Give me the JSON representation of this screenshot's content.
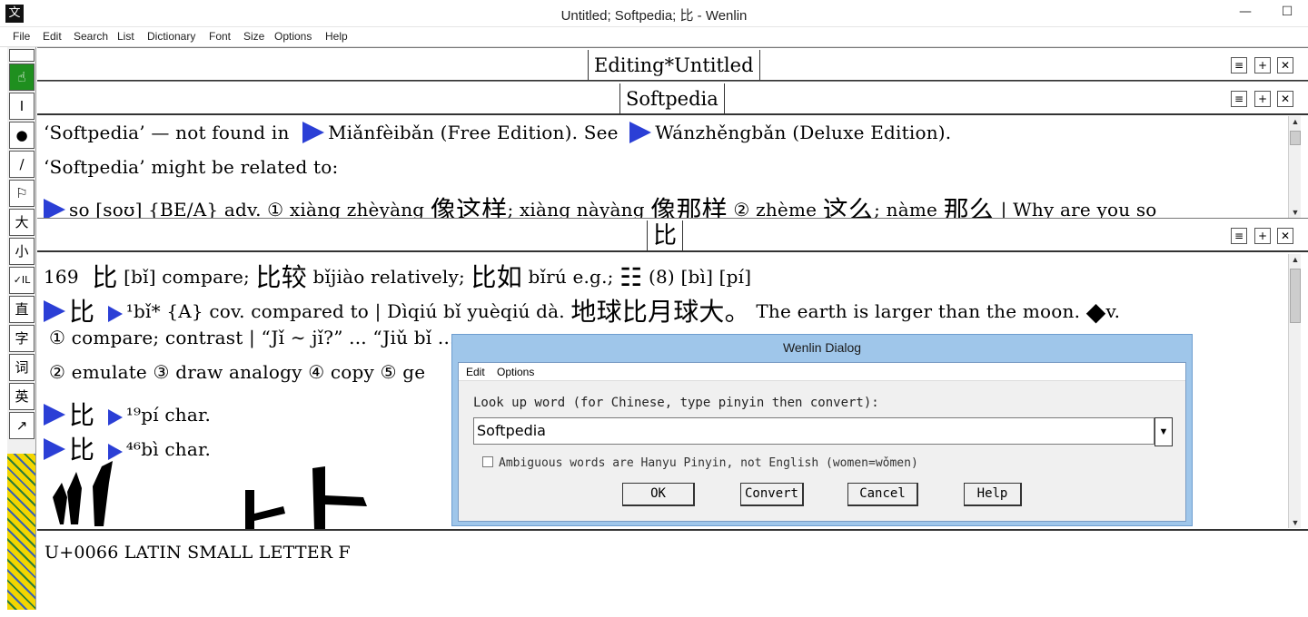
{
  "window": {
    "title": "Untitled; Softpedia; 比 - Wenlin",
    "app_icon": "文",
    "minimize": "—",
    "maximize": "☐",
    "close": "✕"
  },
  "menu": [
    "File",
    "Edit",
    "Search",
    "List",
    "Dictionary",
    "Font",
    "Size",
    "Options",
    "Help"
  ],
  "toolbar": [
    {
      "icon": "hand-icon",
      "glyph": "☝"
    },
    {
      "icon": "text-cursor-icon",
      "glyph": "I"
    },
    {
      "icon": "dot-icon",
      "glyph": "●"
    },
    {
      "icon": "brush-icon",
      "glyph": "∕"
    },
    {
      "icon": "flag-icon",
      "glyph": "⚐"
    },
    {
      "icon": "big-char-icon",
      "glyph": "大"
    },
    {
      "icon": "small-char-icon",
      "glyph": "小"
    },
    {
      "icon": "check-il-icon",
      "glyph": "✓IL"
    },
    {
      "icon": "vertical-icon",
      "glyph": "直"
    },
    {
      "icon": "character-icon",
      "glyph": "字"
    },
    {
      "icon": "word-icon",
      "glyph": "词"
    },
    {
      "icon": "english-icon",
      "glyph": "英"
    },
    {
      "icon": "arrow-icon",
      "glyph": "↗"
    }
  ],
  "pane_controls": {
    "menu": "≡",
    "add": "+",
    "close": "✕"
  },
  "editing_pane": {
    "title": "Editing*Untitled"
  },
  "softpedia_pane": {
    "title": "Softpedia",
    "line1_a": "‘Softpedia’ — not found in",
    "line1_b": "Miǎnfèibǎn (Free Edition). See",
    "line1_c": "Wánzhěngbǎn (Deluxe Edition).",
    "line2": "‘Softpedia’ might be related to:",
    "line3_a": "so [soʊ] {BE/A} adv. ① xiàng zhèyàng",
    "line3_b": "像这样",
    "line3_c": "; xiàng nàyàng",
    "line3_d": "像那样",
    "line3_e": " ② zhème",
    "line3_f": "这么",
    "line3_g": "; nàme",
    "line3_h": "那么",
    "line3_i": "| Why are you so"
  },
  "bi_pane": {
    "title": "比",
    "l1_a": "169",
    "l1_b": "比",
    "l1_c": "[bǐ] compare;",
    "l1_d": "比较",
    "l1_e": "bǐjiào relatively;",
    "l1_f": "比如",
    "l1_g": "bǐrú e.g.;",
    "l1_h": "☷",
    "l1_i": "(8)  [bì] [pí]",
    "l2_a": "比",
    "l2_b": "¹bǐ* {A} cov. compared to | Dìqiú bǐ yuèqiú dà.",
    "l2_c": "地球比月球大。",
    "l2_d": " The earth is larger than the moon.",
    "l2_e": "◆",
    "l2_f": "v.",
    "l3": "① compare; contrast | “Jǐ ∼ jǐ?” ... “Jiǔ bǐ ...",
    "l4": "② emulate  ③ draw analogy  ④ copy  ⑤ ge",
    "l5_a": "比",
    "l5_b": "¹⁹pí char.",
    "l6_a": "比",
    "l6_b": "⁴⁶bì char."
  },
  "status": {
    "text": "U+0066 LATIN SMALL LETTER F"
  },
  "dialog": {
    "title": "Wenlin Dialog",
    "menu": [
      "Edit",
      "Options"
    ],
    "label": "Look up word (for Chinese, type pinyin then convert):",
    "value": "Softpedia",
    "dropdown": "▼",
    "checkbox": "Ambiguous words are Hanyu Pinyin, not English (women=wǒmen)",
    "buttons": [
      "OK",
      "Convert",
      "Cancel",
      "Help"
    ]
  }
}
